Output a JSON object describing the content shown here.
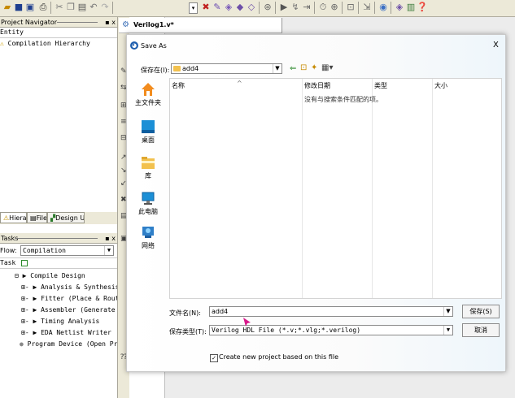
{
  "app": {
    "editor_tab": "Verilog1.v*"
  },
  "project_navigator": {
    "title": "Project Navigator",
    "close": "▪ x",
    "column_header": "Entity",
    "tree_item": "Compilation Hierarchy",
    "tabs": [
      "Hierarchy",
      "Files",
      "Design Units"
    ]
  },
  "tasks": {
    "title": "Tasks",
    "close": "▪ x",
    "flow_label": "Flow:",
    "flow_value": "Compilation",
    "column_header": "Task",
    "rows": [
      {
        "prefix": "⊟  ▶",
        "text": "Compile Design"
      },
      {
        "prefix": "⊞- ▶",
        "text": "Analysis & Synthesis"
      },
      {
        "prefix": "⊞- ▶",
        "text": "Fitter (Place & Route)"
      },
      {
        "prefix": "⊞- ▶",
        "text": "Assembler (Generate programm"
      },
      {
        "prefix": "⊞- ▶",
        "text": "Timing Analysis"
      },
      {
        "prefix": "⊞- ▶",
        "text": "EDA Netlist Writer"
      },
      {
        "prefix": "●",
        "text": "Program Device (Open Programmer)"
      }
    ]
  },
  "dialog": {
    "title": "Save As",
    "close": "X",
    "save_in_label": "保存在(I):",
    "save_in_value": "add4",
    "places": [
      {
        "label": "主文件夹",
        "icon": "home-icon"
      },
      {
        "label": "桌面",
        "icon": "desktop-icon"
      },
      {
        "label": "库",
        "icon": "library-icon"
      },
      {
        "label": "此电脑",
        "icon": "computer-icon"
      },
      {
        "label": "网络",
        "icon": "network-icon"
      }
    ],
    "columns": {
      "name": "名称",
      "modified": "修改日期",
      "type": "类型",
      "size": "大小"
    },
    "empty_message": "没有与搜索条件匹配的项。",
    "filename_label": "文件名(N):",
    "filename_value": "add4",
    "filetype_label": "保存类型(T):",
    "filetype_value": "Verilog HDL File (*.v;*.vlg;*.verilog)",
    "save_button": "保存(S)",
    "cancel_button": "取消",
    "checkbox_label": "Create new project based on this file",
    "checkbox_checked": true
  },
  "colors": {
    "folder": "#f2c14e",
    "home": "#f28c1e",
    "desktop": "#1b8fd6",
    "network": "#2f7fc8",
    "cursor": "#d8188a"
  }
}
